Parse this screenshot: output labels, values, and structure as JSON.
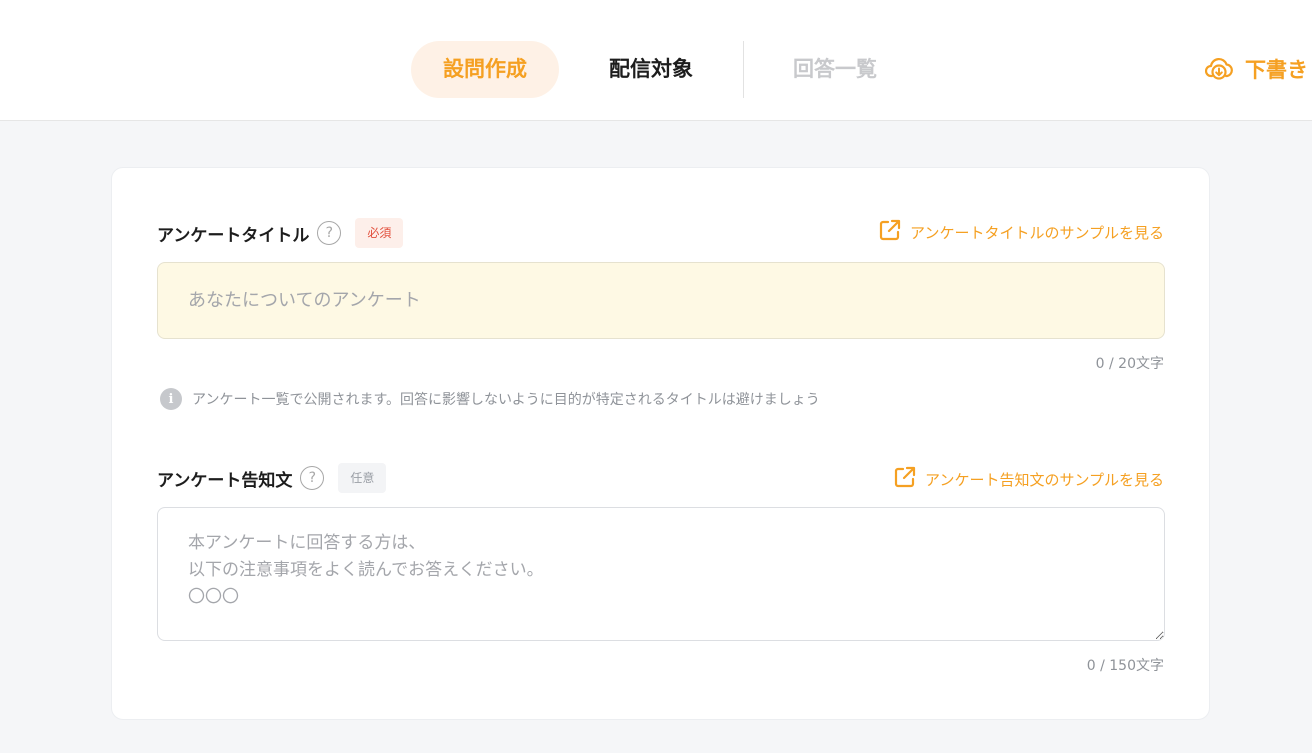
{
  "header": {
    "tabs": [
      {
        "label": "設問作成",
        "state": "active"
      },
      {
        "label": "配信対象",
        "state": "normal"
      },
      {
        "label": "回答一覧",
        "state": "disabled"
      }
    ],
    "draft_button": {
      "label": "下書き",
      "icon": "cloud-download-icon"
    }
  },
  "form": {
    "title_field": {
      "label": "アンケートタイトル",
      "badge": "必須",
      "sample_link": "アンケートタイトルのサンプルを見る",
      "placeholder": "あなたについてのアンケート",
      "value": "",
      "counter": "0 / 20文字",
      "info_note": "アンケート一覧で公開されます。回答に影響しないように目的が特定されるタイトルは避けましょう"
    },
    "notice_field": {
      "label": "アンケート告知文",
      "badge": "任意",
      "sample_link": "アンケート告知文のサンプルを見る",
      "placeholder": "本アンケートに回答する方は、\n以下の注意事項をよく読んでお答えください。\n〇〇〇",
      "value": "",
      "counter": "0 / 150文字"
    }
  },
  "colors": {
    "accent": "#f5a022",
    "accent_bg": "#fef1e6",
    "required": "#e24f3c",
    "input_highlight": "#fef9e4"
  }
}
